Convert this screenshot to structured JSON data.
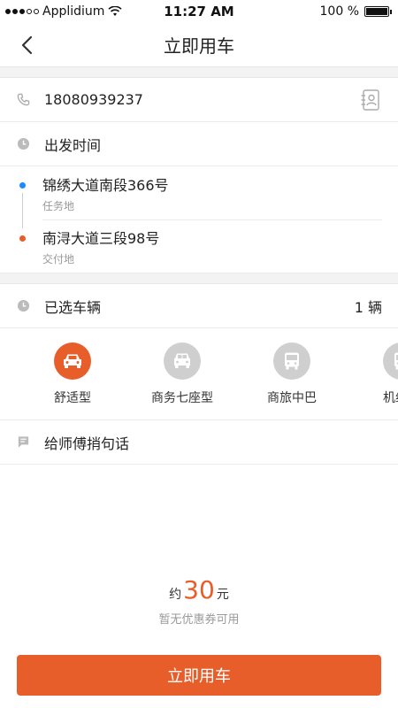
{
  "status_bar": {
    "carrier": "Applidium",
    "time": "11:27 AM",
    "battery": "100 %"
  },
  "nav": {
    "title": "立即用车"
  },
  "phone": {
    "number": "18080939237"
  },
  "departure": {
    "label": "出发时间"
  },
  "route": {
    "start": {
      "address": "锦绣大道南段366号",
      "type": "任务地",
      "color": "#1a8cff"
    },
    "end": {
      "address": "南浔大道三段98号",
      "type": "交付地",
      "color": "#e85e2a"
    }
  },
  "vehicle_select": {
    "label": "已选车辆",
    "count": "1 辆"
  },
  "vehicles": [
    {
      "label": "舒适型",
      "icon": "car-icon",
      "active": true
    },
    {
      "label": "商务七座型",
      "icon": "van-icon",
      "active": false
    },
    {
      "label": "商旅中巴",
      "icon": "bus-icon",
      "active": false
    },
    {
      "label": "机组专",
      "icon": "bus-icon",
      "active": false
    }
  ],
  "message": {
    "label": "给师傅捎句话"
  },
  "price": {
    "prefix": "约",
    "amount": "30",
    "unit": "元",
    "coupon": "暂无优惠券可用"
  },
  "submit": {
    "label": "立即用车"
  },
  "colors": {
    "accent": "#e85e2a",
    "blue": "#1a8cff"
  }
}
